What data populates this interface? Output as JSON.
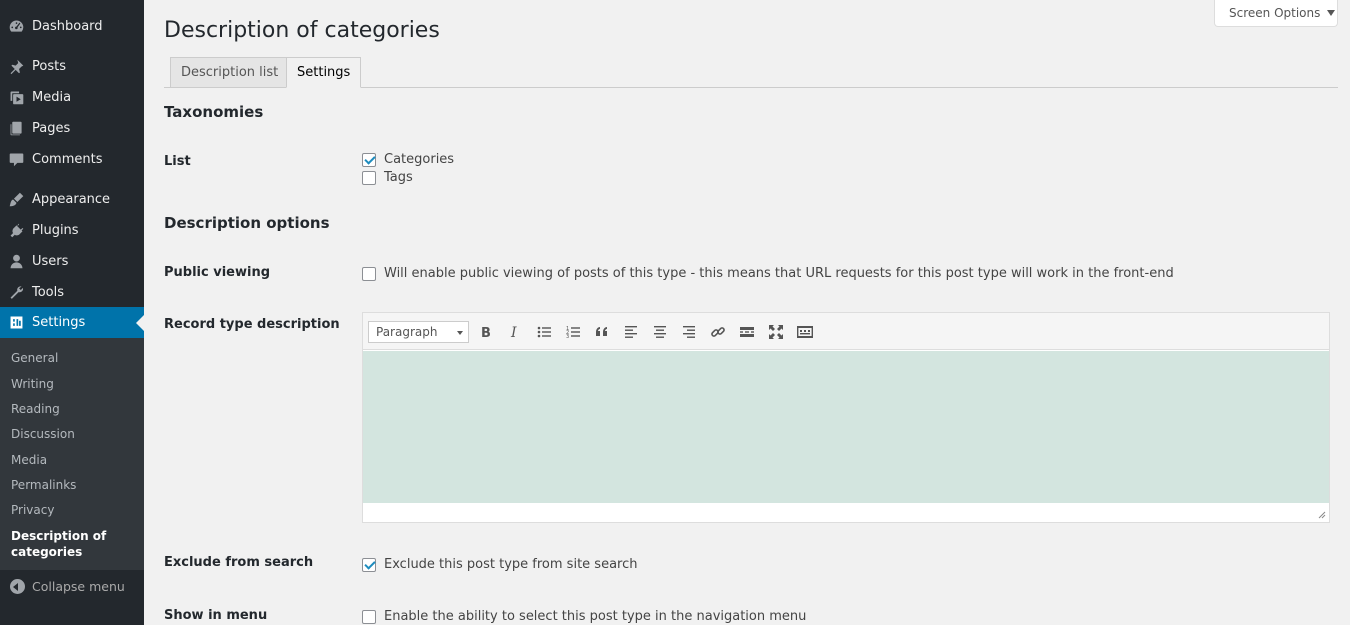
{
  "sidebar": {
    "items": [
      {
        "label": "Dashboard",
        "icon": "dashboard-icon"
      },
      {
        "label": "Posts",
        "icon": "pin-icon"
      },
      {
        "label": "Media",
        "icon": "media-icon"
      },
      {
        "label": "Pages",
        "icon": "pages-icon"
      },
      {
        "label": "Comments",
        "icon": "comment-icon"
      },
      {
        "label": "Appearance",
        "icon": "brush-icon"
      },
      {
        "label": "Plugins",
        "icon": "plug-icon"
      },
      {
        "label": "Users",
        "icon": "user-icon"
      },
      {
        "label": "Tools",
        "icon": "wrench-icon"
      },
      {
        "label": "Settings",
        "icon": "settings-icon"
      }
    ],
    "submenu": [
      "General",
      "Writing",
      "Reading",
      "Discussion",
      "Media",
      "Permalinks",
      "Privacy",
      "Description of categories"
    ],
    "collapse_label": "Collapse menu",
    "accent": "#0073aa"
  },
  "header": {
    "screen_options": "Screen Options",
    "title": "Description of categories",
    "tabs": [
      {
        "label": "Description list",
        "active": false
      },
      {
        "label": "Settings",
        "active": true
      }
    ]
  },
  "taxonomies": {
    "title": "Taxonomies",
    "list_label": "List",
    "options": [
      {
        "label": "Categories",
        "checked": true
      },
      {
        "label": "Tags",
        "checked": false
      }
    ]
  },
  "description_options": {
    "title": "Description options",
    "public_viewing_label": "Public viewing",
    "public_viewing_text": "Will enable public viewing of posts of this type - this means that URL requests for this post type will work in the front-end",
    "public_viewing_checked": false,
    "record_type_label": "Record type description",
    "editor": {
      "format": "Paragraph",
      "buttons": [
        "bold-icon",
        "italic-icon",
        "bullet-list-icon",
        "numbered-list-icon",
        "blockquote-icon",
        "align-left-icon",
        "align-center-icon",
        "align-right-icon",
        "link-icon",
        "read-more-icon",
        "fullscreen-icon",
        "toolbar-toggle-icon"
      ],
      "area_color": "#d3e5df"
    },
    "exclude_label": "Exclude from search",
    "exclude_text": "Exclude this post type from site search",
    "exclude_checked": true,
    "menu_label": "Show in menu",
    "menu_text": "Enable the ability to select this post type in the navigation menu",
    "menu_checked": false
  }
}
